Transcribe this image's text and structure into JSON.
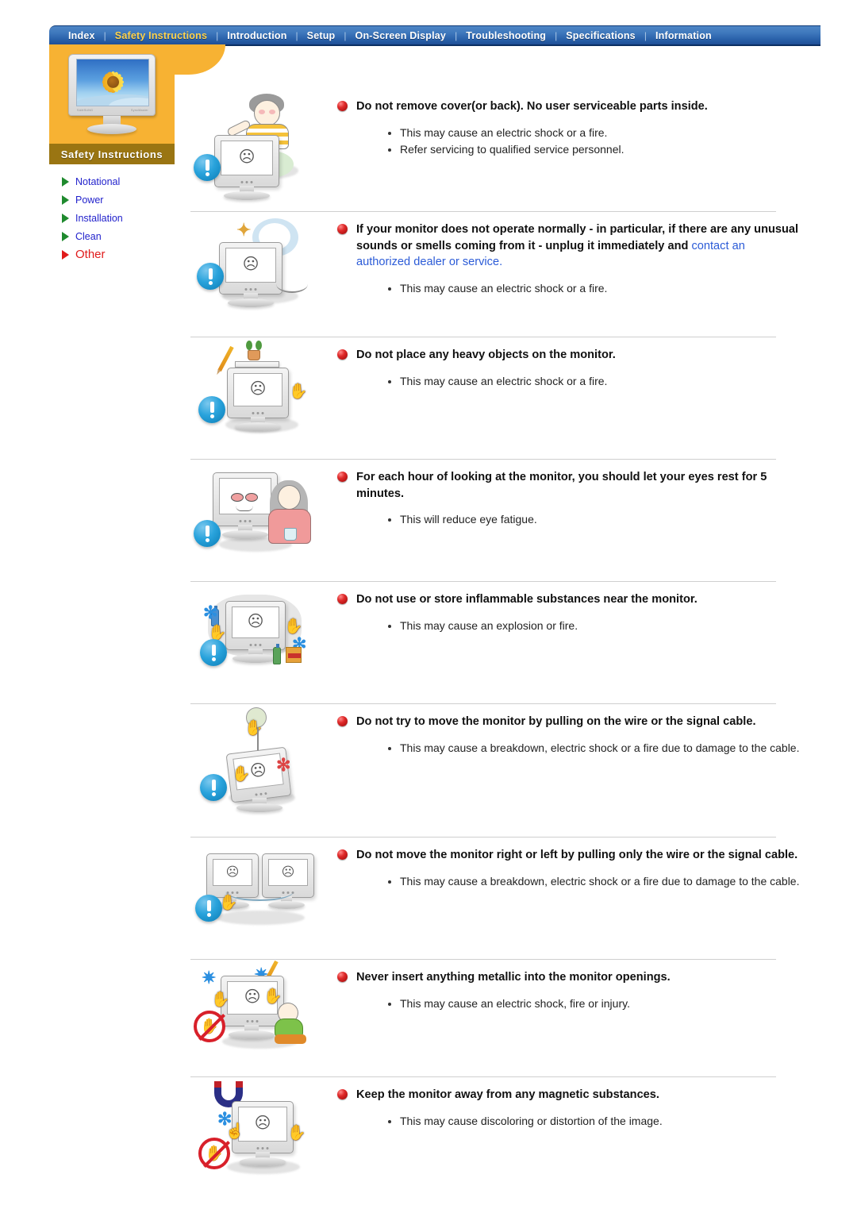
{
  "nav": {
    "items": [
      {
        "label": "Index",
        "active": false
      },
      {
        "label": "Safety Instructions",
        "active": true
      },
      {
        "label": "Introduction",
        "active": false
      },
      {
        "label": "Setup",
        "active": false
      },
      {
        "label": "On-Screen Display",
        "active": false
      },
      {
        "label": "Troubleshooting",
        "active": false
      },
      {
        "label": "Specifications",
        "active": false
      },
      {
        "label": "Information",
        "active": false
      }
    ],
    "separator": "|"
  },
  "sidebar": {
    "panel_title": "Safety Instructions",
    "thumbnail_icon": "monitor-sunflower-icon",
    "items": [
      {
        "label": "Notational",
        "current": false
      },
      {
        "label": "Power",
        "current": false
      },
      {
        "label": "Installation",
        "current": false
      },
      {
        "label": "Clean",
        "current": false
      },
      {
        "label": "Other",
        "current": true
      }
    ]
  },
  "colors": {
    "nav_blue": "#2a62ab",
    "nav_active_text": "#ffd34d",
    "sidebar_orange": "#f7b233",
    "sidebar_title_bar": "#9a7512",
    "link_blue": "#2b5bd7",
    "current_item_red": "#e01b1b",
    "menu_green_arrow": "#1f8a2e",
    "bullet_red": "#e02b2b",
    "exclamation_blue": "#29a3dc"
  },
  "sections": [
    {
      "illustration": "man-removing-monitor-cover-icon",
      "heading": "Do not remove cover(or back). No user serviceable parts inside.",
      "heading_link": "",
      "notes": [
        "This may cause an electric shock or a fire.",
        "Refer servicing to qualified service personnel."
      ]
    },
    {
      "illustration": "monitor-smoke-unplug-icon",
      "heading": "If your monitor does not operate normally - in particular, if there are any unusual sounds or smells coming from it - unplug it immediately and ",
      "heading_link": "contact an authorized dealer or service.",
      "notes": [
        "This may cause an electric shock or a fire."
      ]
    },
    {
      "illustration": "heavy-objects-on-monitor-icon",
      "heading": "Do not place any heavy objects on the monitor.",
      "heading_link": "",
      "notes": [
        "This may cause an electric shock or a fire."
      ]
    },
    {
      "illustration": "woman-resting-eyes-icon",
      "heading": "For each hour of looking at the monitor, you should let your eyes rest for 5 minutes.",
      "heading_link": "",
      "notes": [
        "This will reduce eye fatigue."
      ]
    },
    {
      "illustration": "inflammable-substances-icon",
      "heading": "Do not use or store inflammable substances near the monitor.",
      "heading_link": "",
      "notes": [
        "This may cause an explosion or fire."
      ]
    },
    {
      "illustration": "pulling-monitor-by-cable-icon",
      "heading": "Do not try to move the monitor by pulling on the wire or the signal cable.",
      "heading_link": "",
      "notes": [
        "This may cause a breakdown, electric shock or a fire due to damage to the cable."
      ]
    },
    {
      "illustration": "moving-monitor-sideways-by-cable-icon",
      "heading": "Do not move the monitor right or left by pulling only the wire or the signal cable.",
      "heading_link": "",
      "notes": [
        "This may cause a breakdown, electric shock or a fire due to damage to the cable."
      ]
    },
    {
      "illustration": "metallic-object-into-openings-icon",
      "heading": "Never insert anything metallic into the monitor openings.",
      "heading_link": "",
      "notes": [
        "This may cause an electric shock, fire or injury."
      ]
    },
    {
      "illustration": "magnet-near-monitor-icon",
      "heading": "Keep the monitor away from any magnetic substances.",
      "heading_link": "",
      "notes": [
        "This may cause discoloring or distortion of the image."
      ]
    }
  ]
}
